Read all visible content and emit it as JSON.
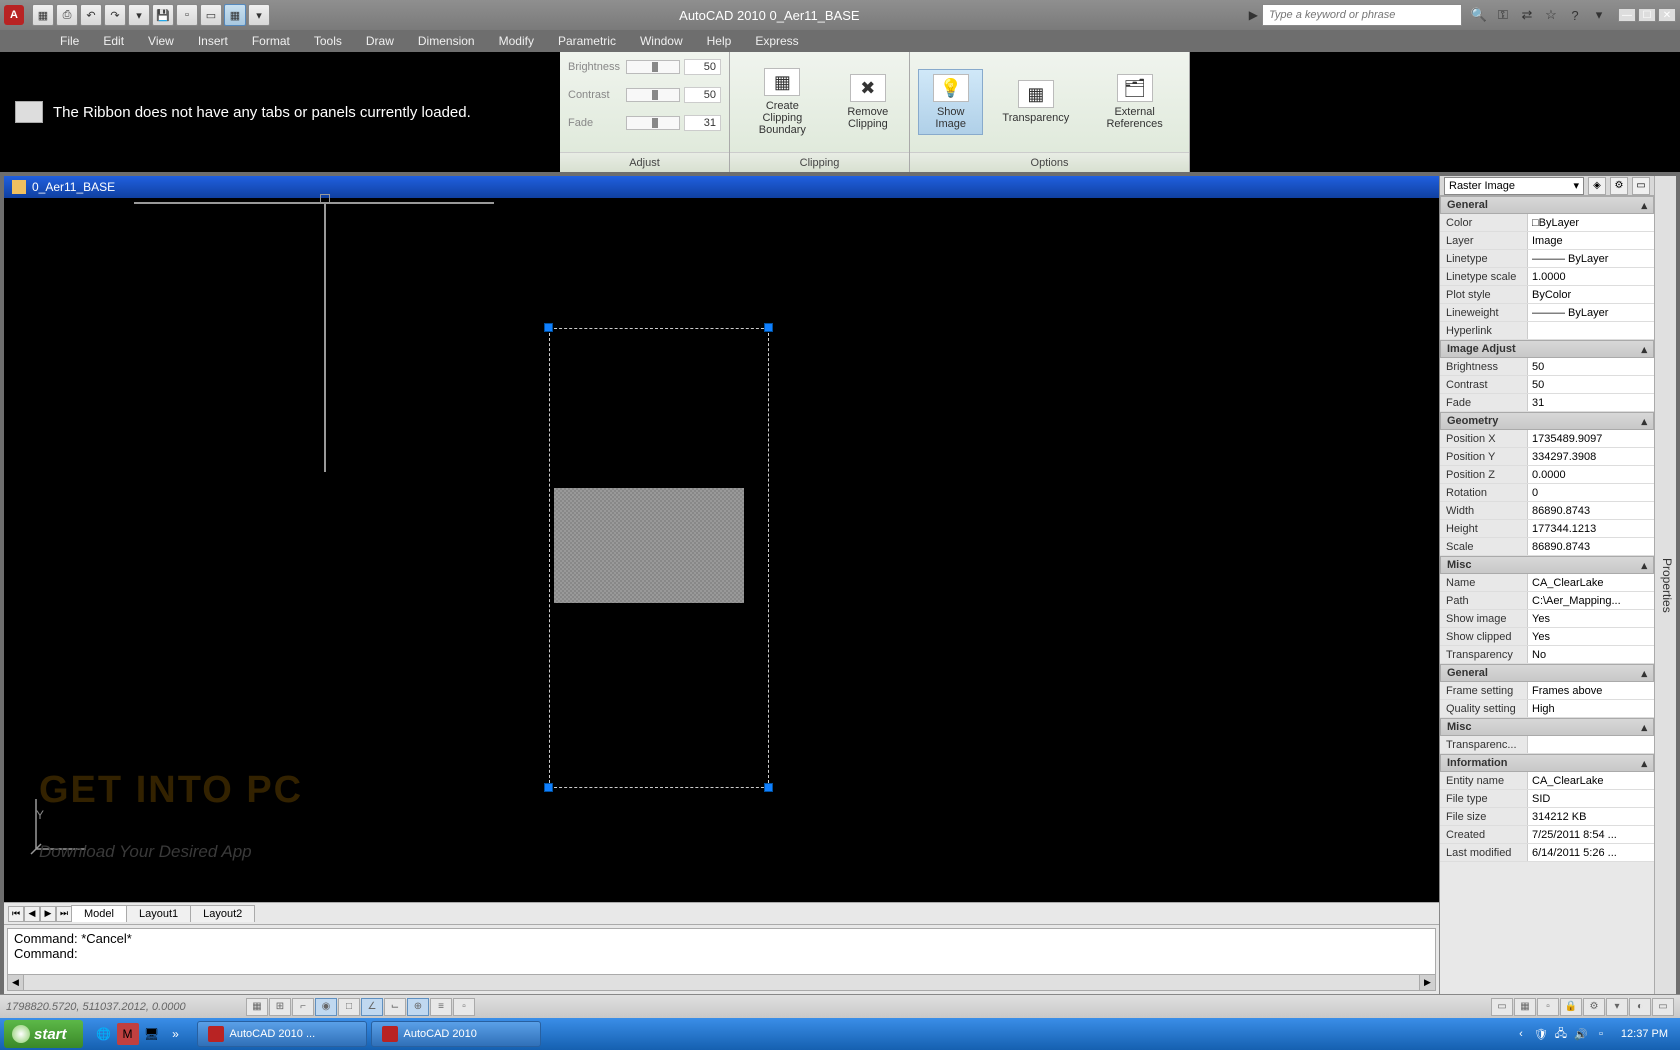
{
  "title": "AutoCAD 2010   0_Aer11_BASE",
  "search_placeholder": "Type a keyword or phrase",
  "menus": [
    "File",
    "Edit",
    "View",
    "Insert",
    "Format",
    "Tools",
    "Draw",
    "Dimension",
    "Modify",
    "Parametric",
    "Window",
    "Help",
    "Express"
  ],
  "ribbon_msg": "The Ribbon does not have any tabs or panels currently loaded.",
  "adjust": {
    "brightness_label": "Brightness",
    "brightness_val": "50",
    "contrast_label": "Contrast",
    "contrast_val": "50",
    "fade_label": "Fade",
    "fade_val": "31",
    "title": "Adjust"
  },
  "clipping": {
    "create": "Create Clipping Boundary",
    "remove": "Remove Clipping",
    "title": "Clipping"
  },
  "options": {
    "show": "Show Image",
    "transparency": "Transparency",
    "extref": "External References",
    "title": "Options"
  },
  "doc_name": "0_Aer11_BASE",
  "watermark1a": "GET ",
  "watermark1b": "INTO PC",
  "watermark2": "Download Your Desired App",
  "layout_tabs": {
    "model": "Model",
    "l1": "Layout1",
    "l2": "Layout2"
  },
  "cmd_line1": "Command: *Cancel*",
  "cmd_line2": "Command:",
  "props_selector": "Raster Image",
  "props": {
    "general": "General",
    "color_l": "Color",
    "color_v": "ByLayer",
    "layer_l": "Layer",
    "layer_v": "Image",
    "linetype_l": "Linetype",
    "linetype_v": "——— ByLayer",
    "ltscale_l": "Linetype scale",
    "ltscale_v": "1.0000",
    "plot_l": "Plot style",
    "plot_v": "ByColor",
    "lweight_l": "Lineweight",
    "lweight_v": "——— ByLayer",
    "hyper_l": "Hyperlink",
    "hyper_v": "",
    "imgadj": "Image Adjust",
    "bright_l": "Brightness",
    "bright_v": "50",
    "contrast_l": "Contrast",
    "contrast_v": "50",
    "fade_l": "Fade",
    "fade_v": "31",
    "geom": "Geometry",
    "posx_l": "Position X",
    "posx_v": "1735489.9097",
    "posy_l": "Position Y",
    "posy_v": "334297.3908",
    "posz_l": "Position Z",
    "posz_v": "0.0000",
    "rot_l": "Rotation",
    "rot_v": "0",
    "width_l": "Width",
    "width_v": "86890.8743",
    "height_l": "Height",
    "height_v": "177344.1213",
    "scale_l": "Scale",
    "scale_v": "86890.8743",
    "misc": "Misc",
    "name_l": "Name",
    "name_v": "CA_ClearLake",
    "path_l": "Path",
    "path_v": "C:\\Aer_Mapping...",
    "showimg_l": "Show image",
    "showimg_v": "Yes",
    "showclip_l": "Show clipped",
    "showclip_v": "Yes",
    "trans_l": "Transparency",
    "trans_v": "No",
    "general2": "General",
    "frame_l": "Frame setting",
    "frame_v": "Frames above",
    "quality_l": "Quality setting",
    "quality_v": "High",
    "misc2": "Misc",
    "transc_l": "Transparenc...",
    "transc_v": "",
    "info": "Information",
    "ename_l": "Entity name",
    "ename_v": "CA_ClearLake",
    "ftype_l": "File type",
    "ftype_v": "SID",
    "fsize_l": "File size",
    "fsize_v": "314212 KB",
    "created_l": "Created",
    "created_v": "7/25/2011 8:54 ...",
    "modified_l": "Last modified",
    "modified_v": "6/14/2011 5:26 ..."
  },
  "props_tab": "Properties",
  "status_coords": "1798820.5720, 511037.2012, 0.0000",
  "taskbar": {
    "start": "start",
    "task1": "AutoCAD 2010 ...",
    "task2": "AutoCAD 2010",
    "clock": "12:37 PM"
  }
}
